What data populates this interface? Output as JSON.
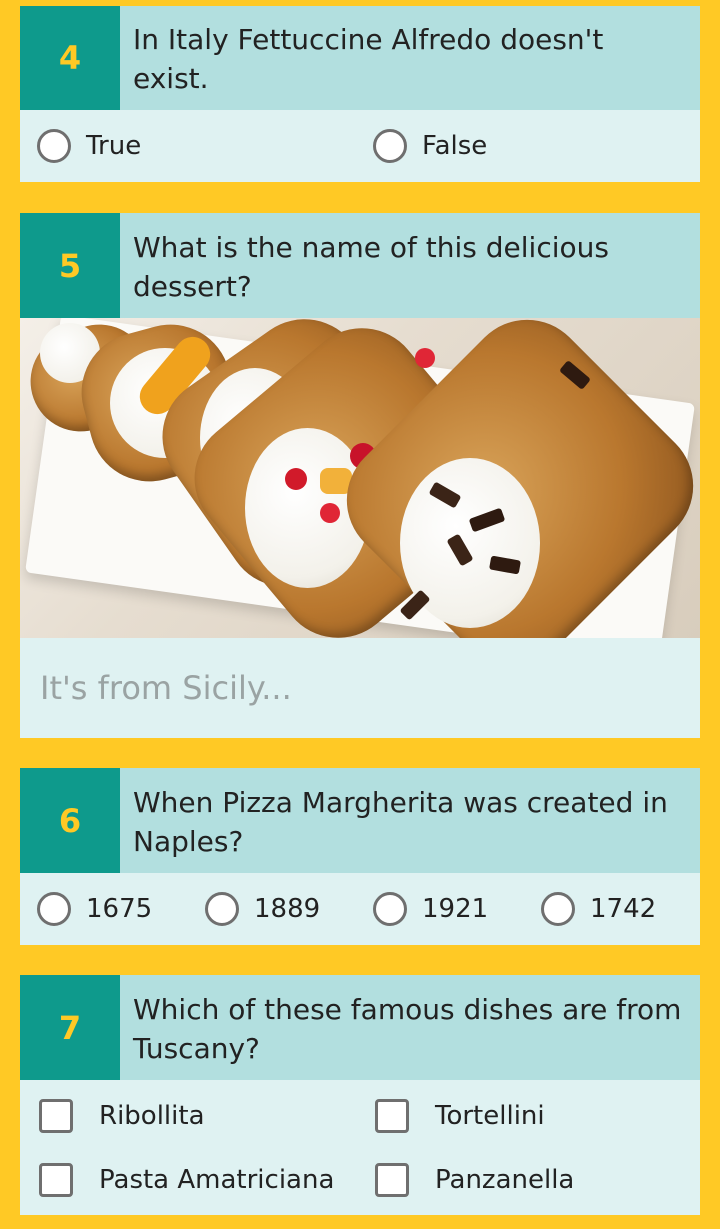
{
  "questions": [
    {
      "number": "4",
      "text": "In Italy Fettuccine Alfredo doesn't exist.",
      "type": "radio",
      "options": [
        "True",
        "False"
      ]
    },
    {
      "number": "5",
      "text": "What is the name of this delicious dessert?",
      "type": "image-text",
      "image_icon": "cannoli-photo",
      "input_placeholder": "It's from Sicily..."
    },
    {
      "number": "6",
      "text": "When Pizza Margherita was created in Naples?",
      "type": "radio",
      "options": [
        "1675",
        "1889",
        "1921",
        "1742"
      ]
    },
    {
      "number": "7",
      "text": "Which of these famous dishes are from Tuscany?",
      "type": "checkbox",
      "options": [
        "Ribollita",
        "Tortellini",
        "Pasta Amatriciana",
        "Panzanella"
      ]
    }
  ],
  "colors": {
    "background": "#FFC925",
    "number_block": "#0E9A8C",
    "number_text": "#FFC925",
    "question_header": "#B2DFDF",
    "card_body": "#DFF2F2"
  }
}
